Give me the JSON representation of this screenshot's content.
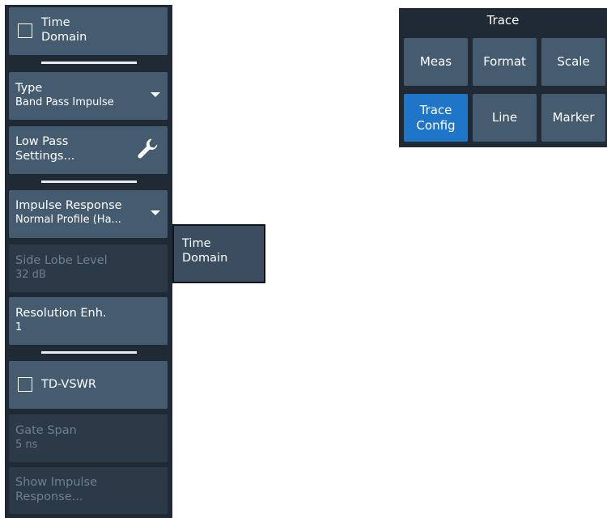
{
  "side_panel": {
    "time_domain": {
      "label_line1": "Time",
      "label_line2": "Domain",
      "checked": false
    },
    "type": {
      "label": "Type",
      "value": "Band Pass Impulse"
    },
    "low_pass_settings": {
      "label_line1": "Low Pass",
      "label_line2": "Settings..."
    },
    "impulse_response": {
      "label": "Impulse Response",
      "value": "Normal Profile (Ha..."
    },
    "side_lobe_level": {
      "label": "Side Lobe Level",
      "value": "32 dB",
      "enabled": false
    },
    "resolution_enh": {
      "label": "Resolution Enh.",
      "value": "1"
    },
    "td_vswr": {
      "label": "TD-VSWR",
      "checked": false
    },
    "gate_span": {
      "label": "Gate Span",
      "value": "5 ns",
      "enabled": false
    },
    "show_impulse_response": {
      "label_line1": "Show Impulse",
      "label_line2": "Response...",
      "enabled": false
    }
  },
  "tooltip": {
    "line1": "Time",
    "line2": "Domain"
  },
  "trace_toolbar": {
    "title": "Trace",
    "buttons": [
      {
        "line1": "Meas",
        "line2": ""
      },
      {
        "line1": "Format",
        "line2": ""
      },
      {
        "line1": "Scale",
        "line2": ""
      },
      {
        "line1": "Trace",
        "line2": "Config",
        "active": true
      },
      {
        "line1": "Line",
        "line2": ""
      },
      {
        "line1": "Marker",
        "line2": ""
      }
    ]
  },
  "colors": {
    "panel_bg": "#1f2a35",
    "button_bg": "#455b70",
    "button_disabled_bg": "#2c3a48",
    "disabled_text": "#6e7f8f",
    "active_accent": "#1f76c8",
    "tooltip_bg": "#3b4d5f"
  }
}
